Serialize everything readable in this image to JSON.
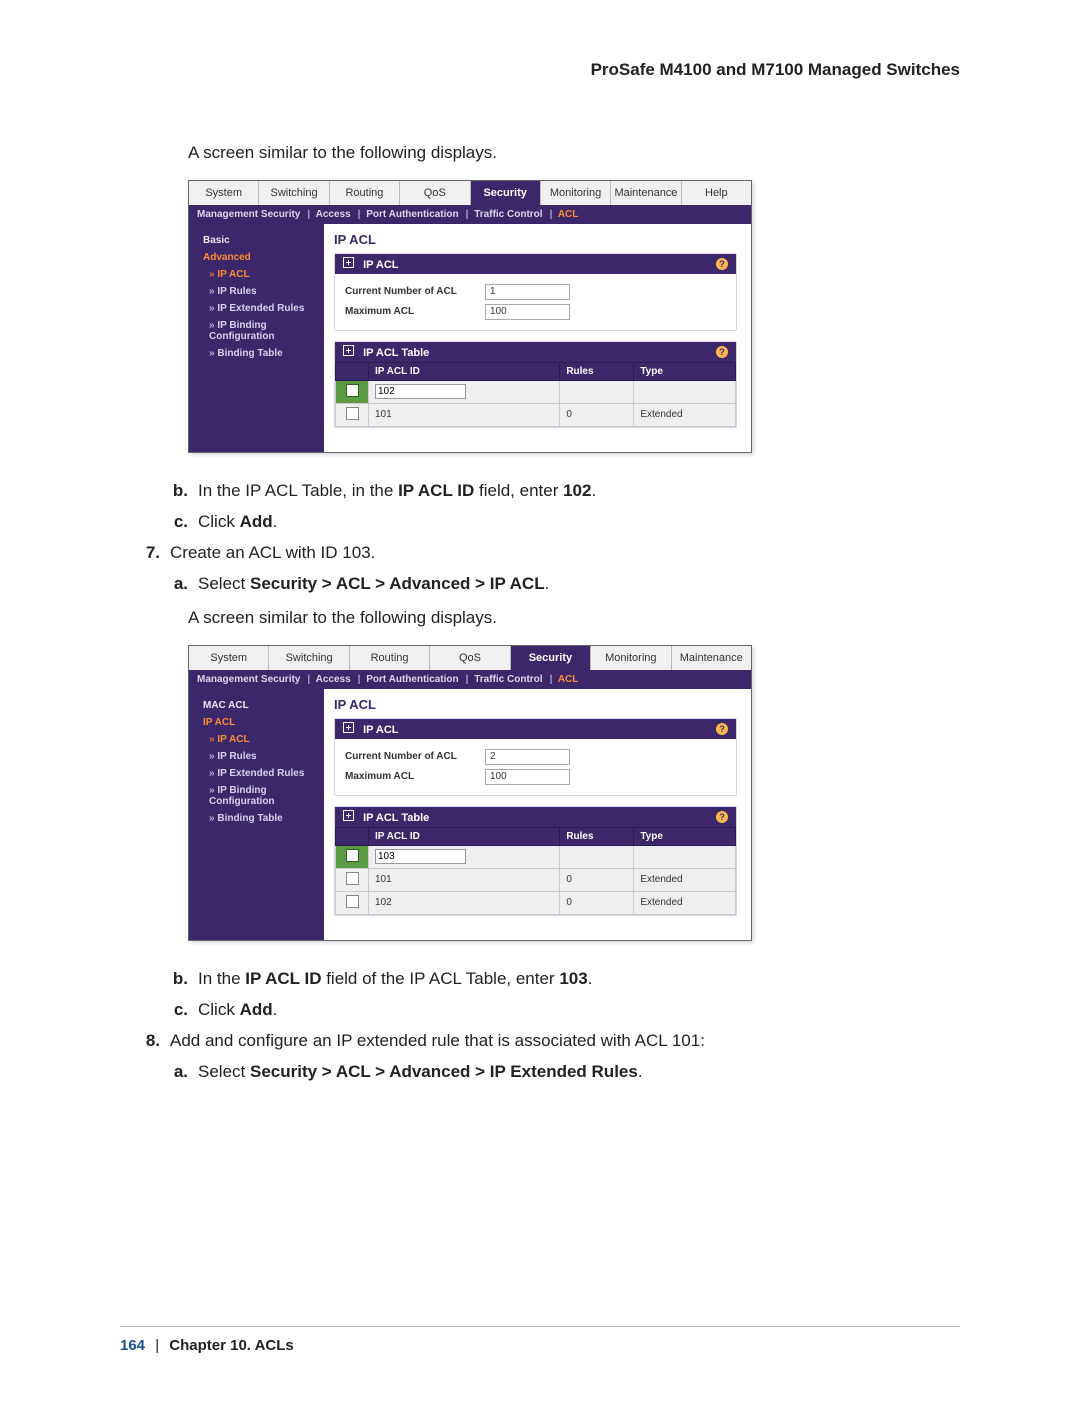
{
  "product_title": "ProSafe M4100 and M7100 Managed Switches",
  "intro1": "A screen similar to the following displays.",
  "shot1": {
    "tabs": [
      "System",
      "Switching",
      "Routing",
      "QoS",
      "Security",
      "Monitoring",
      "Maintenance",
      "Help"
    ],
    "active_tab": "Security",
    "subnav": [
      "Management Security",
      "Access",
      "Port Authentication",
      "Traffic Control",
      "ACL"
    ],
    "active_subnav": "ACL",
    "side": [
      "Basic",
      "Advanced",
      "IP ACL",
      "IP Rules",
      "IP Extended Rules",
      "IP Binding Configuration",
      "Binding Table"
    ],
    "side_active": "Advanced",
    "side_selected": "IP ACL",
    "page_title": "IP ACL",
    "box1_title": "IP ACL",
    "kv": [
      {
        "k": "Current Number of ACL",
        "v": "1"
      },
      {
        "k": "Maximum ACL",
        "v": "100"
      }
    ],
    "box2_title": "IP ACL Table",
    "cols": [
      "IP ACL ID",
      "Rules",
      "Type"
    ],
    "rows": [
      {
        "checked": true,
        "id_input": "102",
        "rules": "",
        "type": ""
      },
      {
        "checked": false,
        "id": "101",
        "rules": "0",
        "type": "Extended"
      }
    ]
  },
  "step_b1_marker": "b.",
  "step_b1_pre": "In the IP ACL Table, in the ",
  "step_b1_bold": "IP ACL ID",
  "step_b1_mid": " field, enter ",
  "step_b1_val": "102",
  "step_b1_post": ".",
  "step_c1_marker": "c.",
  "step_c1_pre": "Click ",
  "step_c1_bold": "Add",
  "step_c1_post": ".",
  "step7_marker": "7.",
  "step7_text": "Create an ACL with ID 103.",
  "step7a_marker": "a.",
  "step7a_pre": "Select ",
  "step7a_bold": "Security > ACL > Advanced > IP ACL",
  "step7a_post": ".",
  "intro2": "A screen similar to the following displays.",
  "shot2": {
    "tabs": [
      "System",
      "Switching",
      "Routing",
      "QoS",
      "Security",
      "Monitoring",
      "Maintenance"
    ],
    "active_tab": "Security",
    "subnav": [
      "Management Security",
      "Access",
      "Port Authentication",
      "Traffic Control",
      "ACL"
    ],
    "active_subnav": "ACL",
    "side": [
      "MAC ACL",
      "IP ACL",
      "IP ACL",
      "IP Rules",
      "IP Extended Rules",
      "IP Binding Configuration",
      "Binding Table"
    ],
    "side_active": "IP ACL",
    "side_selected": "IP ACL",
    "page_title": "IP ACL",
    "box1_title": "IP ACL",
    "kv": [
      {
        "k": "Current Number of ACL",
        "v": "2"
      },
      {
        "k": "Maximum ACL",
        "v": "100"
      }
    ],
    "box2_title": "IP ACL Table",
    "cols": [
      "IP ACL ID",
      "Rules",
      "Type"
    ],
    "rows": [
      {
        "checked": true,
        "id_input": "103",
        "rules": "",
        "type": ""
      },
      {
        "checked": false,
        "id": "101",
        "rules": "0",
        "type": "Extended"
      },
      {
        "checked": false,
        "id": "102",
        "rules": "0",
        "type": "Extended"
      }
    ]
  },
  "step_b2_marker": "b.",
  "step_b2_pre": "In the ",
  "step_b2_bold": "IP ACL ID",
  "step_b2_mid": " field of the IP ACL Table, enter ",
  "step_b2_val": "103",
  "step_b2_post": ".",
  "step_c2_marker": "c.",
  "step_c2_pre": "Click ",
  "step_c2_bold": "Add",
  "step_c2_post": ".",
  "step8_marker": "8.",
  "step8_text": "Add and configure an IP extended rule that is associated with ACL 101:",
  "step8a_marker": "a.",
  "step8a_pre": "Select ",
  "step8a_bold": "Security > ACL > Advanced > IP Extended Rules",
  "step8a_post": ".",
  "footer_page": "164",
  "footer_sep": "|",
  "footer_chapter": "Chapter 10.  ACLs"
}
